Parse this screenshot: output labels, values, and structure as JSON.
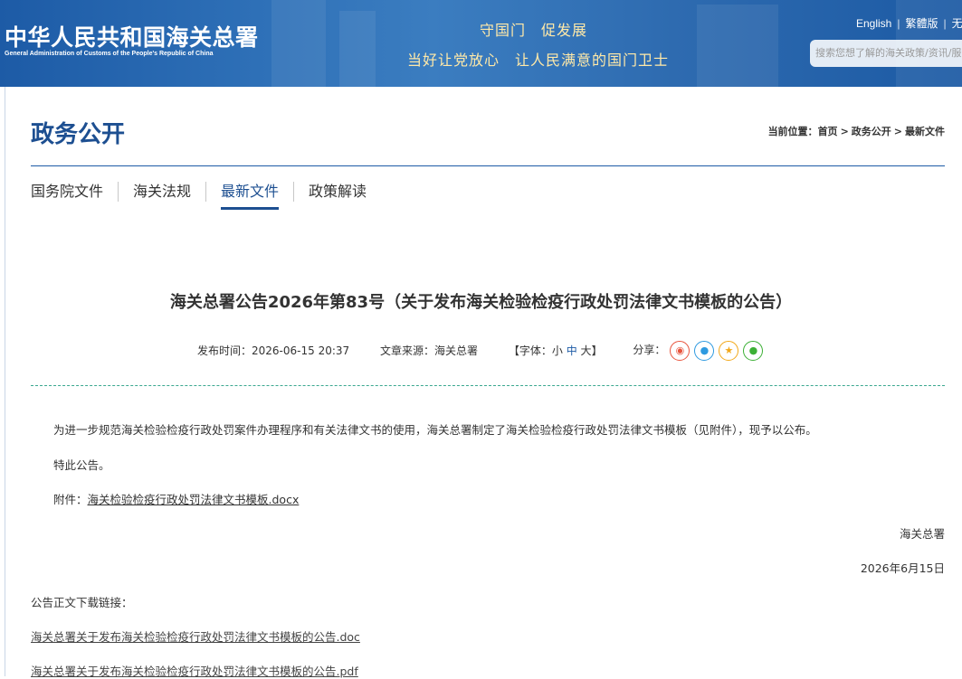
{
  "header": {
    "logo_cn": "中华人民共和国海关总署",
    "logo_en": "General Administration of Customs of the People's Republic of China",
    "slogan_line1": "守国门　促发展",
    "slogan_line2": "当好让党放心　让人民满意的国门卫士",
    "lang_english": "English",
    "lang_traditional": "繁體版",
    "lang_other": "无",
    "lang_separator": "|",
    "search_placeholder": "搜索您想了解的海关政策/资讯/服务"
  },
  "section": {
    "title": "政务公开",
    "breadcrumb_prefix": "当前位置：",
    "breadcrumb": [
      "首页",
      "政务公开",
      "最新文件"
    ],
    "breadcrumb_separator": ">"
  },
  "tabs": [
    {
      "label": "国务院文件",
      "active": false
    },
    {
      "label": "海关法规",
      "active": false
    },
    {
      "label": "最新文件",
      "active": true
    },
    {
      "label": "政策解读",
      "active": false
    }
  ],
  "article": {
    "title": "海关总署公告2026年第83号（关于发布海关检验检疫行政处罚法律文书模板的公告）",
    "publish_time_label": "发布时间：",
    "publish_time": "2026-06-15 20:37",
    "source_label": "文章来源：",
    "source": "海关总署",
    "font_label_open": "【字体：",
    "font_small": "小",
    "font_medium": "中",
    "font_large": "大",
    "font_label_close": "】",
    "share_label": "分享：",
    "share_icons": [
      {
        "name": "weibo-icon",
        "glyph": "◉",
        "color": "#e8553e"
      },
      {
        "name": "qq-icon",
        "glyph": "●",
        "color": "#2e9ae0"
      },
      {
        "name": "qzone-icon",
        "glyph": "★",
        "color": "#f2a81a"
      },
      {
        "name": "wechat-icon",
        "glyph": "●",
        "color": "#3cb035"
      }
    ],
    "body_para1": "为进一步规范海关检验检疫行政处罚案件办理程序和有关法律文书的使用，海关总署制定了海关检验检疫行政处罚法律文书模板（见附件），现予以公布。",
    "body_para2": "特此公告。",
    "attachment_label": "附件：",
    "attachment_link": "海关检验检疫行政处罚法律文书模板.docx",
    "signature": "海关总署",
    "date": "2026年6月15日",
    "download_label": "公告正文下载链接：",
    "download_links": [
      "海关总署关于发布海关检验检疫行政处罚法律文书模板的公告.doc",
      "海关总署关于发布海关检验检疫行政处罚法律文书模板的公告.pdf"
    ]
  },
  "colors": {
    "brand_blue": "#1d4f91",
    "header_blue": "#2f71b8",
    "slogan_gold": "#ffe9a8",
    "divider_teal": "#3aa88f"
  }
}
